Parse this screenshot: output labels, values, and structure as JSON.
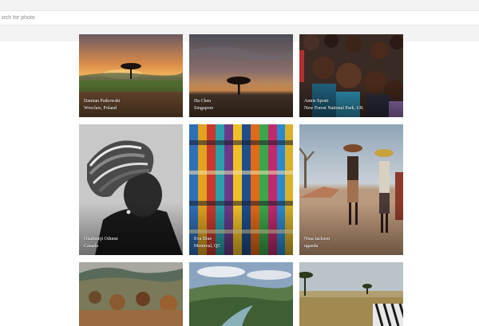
{
  "search": {
    "placeholder": "Search for photo"
  },
  "gallery": {
    "photos": [
      {
        "author": "Damian Patkowski",
        "location": "Wroclaw, Poland",
        "subject": "savanna sunset with acacia tree"
      },
      {
        "author": "Ha Chen",
        "location": "Singapore",
        "subject": "acacia tree silhouette at dusk"
      },
      {
        "author": "Annie Spratt",
        "location": "New Forest National Park, UK",
        "subject": "group of smiling children"
      },
      {
        "author": "Oladimeji Odunsi",
        "location": "Canada",
        "subject": "black and white portrait with patterned headwrap"
      },
      {
        "author": "Eva Blue",
        "location": "Montreal, QC",
        "subject": "stacked colorful wax print fabrics"
      },
      {
        "author": "Nina Jackson",
        "location": "uganda",
        "subject": "children carrying bowls on a dirt road"
      },
      {
        "author": "",
        "location": "",
        "subject": "hills and shrubland"
      },
      {
        "author": "",
        "location": "",
        "subject": "green river valley with clouds"
      },
      {
        "author": "",
        "location": "",
        "subject": "grassland with zebra and trees"
      }
    ]
  }
}
